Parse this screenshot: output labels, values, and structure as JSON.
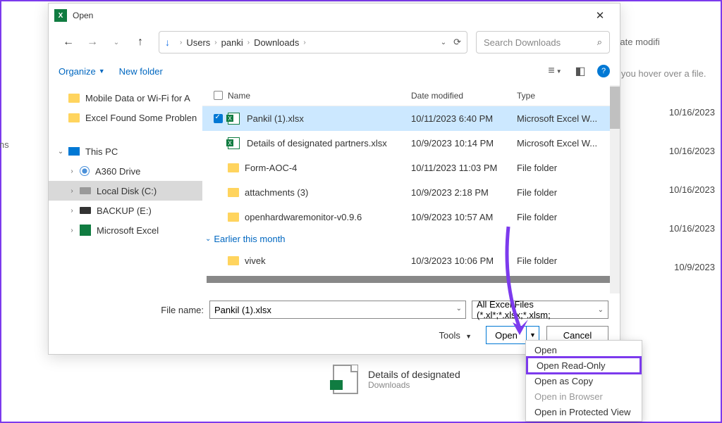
{
  "dialog": {
    "title": "Open",
    "breadcrumbs": [
      "Users",
      "panki",
      "Downloads"
    ],
    "search_placeholder": "Search Downloads",
    "organize": "Organize",
    "new_folder": "New folder",
    "file_name_label": "File name:",
    "file_name_value": "Pankil (1).xlsx",
    "filter": "All Excel Files (*.xl*;*.xlsx;*.xlsm;",
    "tools": "Tools",
    "open_btn": "Open",
    "cancel_btn": "Cancel",
    "columns": {
      "name": "Name",
      "date": "Date modified",
      "type": "Type"
    },
    "group_earlier": "Earlier this month"
  },
  "sidebar": {
    "quick": [
      "Mobile Data or Wi-Fi for A",
      "Excel Found Some Problen"
    ],
    "this_pc": "This PC",
    "drives": [
      "A360 Drive",
      "Local Disk (C:)",
      "BACKUP (E:)",
      "Microsoft Excel"
    ]
  },
  "files": [
    {
      "name": "Pankil (1).xlsx",
      "date": "10/11/2023 6:40 PM",
      "type": "Microsoft Excel W...",
      "kind": "xlsx",
      "selected": true
    },
    {
      "name": "Details of designated partners.xlsx",
      "date": "10/9/2023 10:14 PM",
      "type": "Microsoft Excel W...",
      "kind": "xlsx",
      "selected": false
    },
    {
      "name": "Form-AOC-4",
      "date": "10/11/2023 11:03 PM",
      "type": "File folder",
      "kind": "folder",
      "selected": false
    },
    {
      "name": "attachments (3)",
      "date": "10/9/2023 2:18 PM",
      "type": "File folder",
      "kind": "folder",
      "selected": false
    },
    {
      "name": "openhardwaremonitor-v0.9.6",
      "date": "10/9/2023 10:57 AM",
      "type": "File folder",
      "kind": "folder",
      "selected": false
    }
  ],
  "files_earlier": [
    {
      "name": "vivek",
      "date": "10/3/2023 10:06 PM",
      "type": "File folder",
      "kind": "folder"
    }
  ],
  "menu": {
    "items": [
      "Open",
      "Open Read-Only",
      "Open as Copy",
      "Open in Browser",
      "Open in Protected View"
    ],
    "highlighted": 1,
    "disabled": [
      3
    ]
  },
  "background": {
    "header": "Date modifi",
    "hint": "n you hover over a file.",
    "ins": "ins",
    "dates": [
      "10/16/2023",
      "10/16/2023",
      "10/16/2023",
      "10/16/2023",
      "10/9/2023"
    ],
    "file_title": "Details of designated",
    "file_sub": "Downloads"
  }
}
